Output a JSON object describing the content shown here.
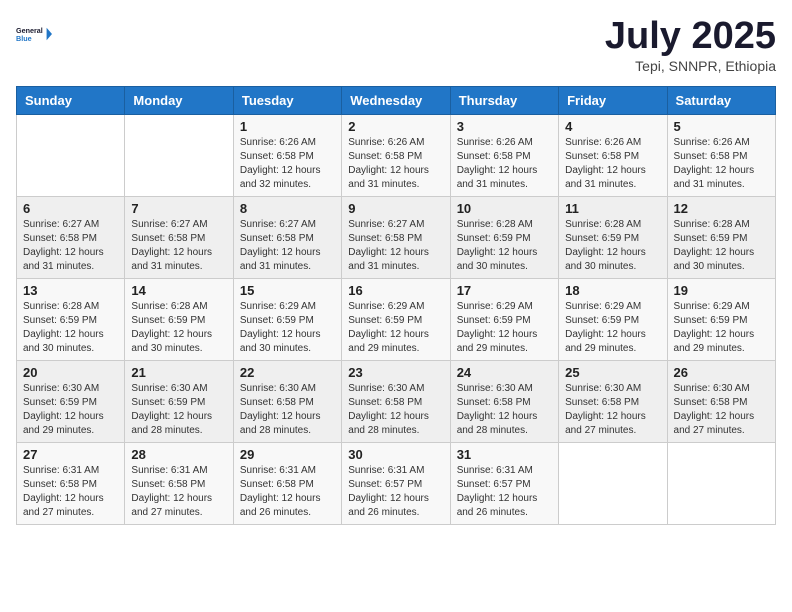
{
  "header": {
    "logo_line1": "General",
    "logo_line2": "Blue",
    "month": "July 2025",
    "location": "Tepi, SNNPR, Ethiopia"
  },
  "weekdays": [
    "Sunday",
    "Monday",
    "Tuesday",
    "Wednesday",
    "Thursday",
    "Friday",
    "Saturday"
  ],
  "weeks": [
    [
      {
        "day": "",
        "info": ""
      },
      {
        "day": "",
        "info": ""
      },
      {
        "day": "1",
        "info": "Sunrise: 6:26 AM\nSunset: 6:58 PM\nDaylight: 12 hours and 32 minutes."
      },
      {
        "day": "2",
        "info": "Sunrise: 6:26 AM\nSunset: 6:58 PM\nDaylight: 12 hours and 31 minutes."
      },
      {
        "day": "3",
        "info": "Sunrise: 6:26 AM\nSunset: 6:58 PM\nDaylight: 12 hours and 31 minutes."
      },
      {
        "day": "4",
        "info": "Sunrise: 6:26 AM\nSunset: 6:58 PM\nDaylight: 12 hours and 31 minutes."
      },
      {
        "day": "5",
        "info": "Sunrise: 6:26 AM\nSunset: 6:58 PM\nDaylight: 12 hours and 31 minutes."
      }
    ],
    [
      {
        "day": "6",
        "info": "Sunrise: 6:27 AM\nSunset: 6:58 PM\nDaylight: 12 hours and 31 minutes."
      },
      {
        "day": "7",
        "info": "Sunrise: 6:27 AM\nSunset: 6:58 PM\nDaylight: 12 hours and 31 minutes."
      },
      {
        "day": "8",
        "info": "Sunrise: 6:27 AM\nSunset: 6:58 PM\nDaylight: 12 hours and 31 minutes."
      },
      {
        "day": "9",
        "info": "Sunrise: 6:27 AM\nSunset: 6:58 PM\nDaylight: 12 hours and 31 minutes."
      },
      {
        "day": "10",
        "info": "Sunrise: 6:28 AM\nSunset: 6:59 PM\nDaylight: 12 hours and 30 minutes."
      },
      {
        "day": "11",
        "info": "Sunrise: 6:28 AM\nSunset: 6:59 PM\nDaylight: 12 hours and 30 minutes."
      },
      {
        "day": "12",
        "info": "Sunrise: 6:28 AM\nSunset: 6:59 PM\nDaylight: 12 hours and 30 minutes."
      }
    ],
    [
      {
        "day": "13",
        "info": "Sunrise: 6:28 AM\nSunset: 6:59 PM\nDaylight: 12 hours and 30 minutes."
      },
      {
        "day": "14",
        "info": "Sunrise: 6:28 AM\nSunset: 6:59 PM\nDaylight: 12 hours and 30 minutes."
      },
      {
        "day": "15",
        "info": "Sunrise: 6:29 AM\nSunset: 6:59 PM\nDaylight: 12 hours and 30 minutes."
      },
      {
        "day": "16",
        "info": "Sunrise: 6:29 AM\nSunset: 6:59 PM\nDaylight: 12 hours and 29 minutes."
      },
      {
        "day": "17",
        "info": "Sunrise: 6:29 AM\nSunset: 6:59 PM\nDaylight: 12 hours and 29 minutes."
      },
      {
        "day": "18",
        "info": "Sunrise: 6:29 AM\nSunset: 6:59 PM\nDaylight: 12 hours and 29 minutes."
      },
      {
        "day": "19",
        "info": "Sunrise: 6:29 AM\nSunset: 6:59 PM\nDaylight: 12 hours and 29 minutes."
      }
    ],
    [
      {
        "day": "20",
        "info": "Sunrise: 6:30 AM\nSunset: 6:59 PM\nDaylight: 12 hours and 29 minutes."
      },
      {
        "day": "21",
        "info": "Sunrise: 6:30 AM\nSunset: 6:59 PM\nDaylight: 12 hours and 28 minutes."
      },
      {
        "day": "22",
        "info": "Sunrise: 6:30 AM\nSunset: 6:58 PM\nDaylight: 12 hours and 28 minutes."
      },
      {
        "day": "23",
        "info": "Sunrise: 6:30 AM\nSunset: 6:58 PM\nDaylight: 12 hours and 28 minutes."
      },
      {
        "day": "24",
        "info": "Sunrise: 6:30 AM\nSunset: 6:58 PM\nDaylight: 12 hours and 28 minutes."
      },
      {
        "day": "25",
        "info": "Sunrise: 6:30 AM\nSunset: 6:58 PM\nDaylight: 12 hours and 27 minutes."
      },
      {
        "day": "26",
        "info": "Sunrise: 6:30 AM\nSunset: 6:58 PM\nDaylight: 12 hours and 27 minutes."
      }
    ],
    [
      {
        "day": "27",
        "info": "Sunrise: 6:31 AM\nSunset: 6:58 PM\nDaylight: 12 hours and 27 minutes."
      },
      {
        "day": "28",
        "info": "Sunrise: 6:31 AM\nSunset: 6:58 PM\nDaylight: 12 hours and 27 minutes."
      },
      {
        "day": "29",
        "info": "Sunrise: 6:31 AM\nSunset: 6:58 PM\nDaylight: 12 hours and 26 minutes."
      },
      {
        "day": "30",
        "info": "Sunrise: 6:31 AM\nSunset: 6:57 PM\nDaylight: 12 hours and 26 minutes."
      },
      {
        "day": "31",
        "info": "Sunrise: 6:31 AM\nSunset: 6:57 PM\nDaylight: 12 hours and 26 minutes."
      },
      {
        "day": "",
        "info": ""
      },
      {
        "day": "",
        "info": ""
      }
    ]
  ]
}
